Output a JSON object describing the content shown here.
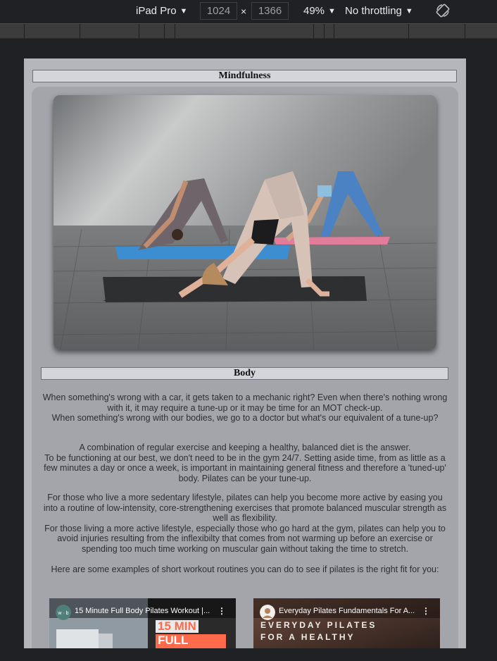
{
  "devtools": {
    "device": "iPad Pro",
    "width": "1024",
    "height": "1366",
    "times": "×",
    "zoom": "49%",
    "throttling": "No throttling",
    "caret": "▼"
  },
  "page": {
    "main_heading": "Mindfulness",
    "hero_alt": "Three women doing downward dog yoga poses on mats",
    "sub_heading": "Body",
    "paragraphs": [
      "When something's wrong with a car, it gets taken to a mechanic right? Even when there's nothing wrong with it, it may require a tune-up or it may be time for an MOT check-up.\nWhen something's wrong with our bodies, we go to a doctor but what's our equivalent of a tune-up?",
      "A combination of regular exercise and keeping a healthy, balanced diet is the answer.\nTo be functioning at our best, we don't need to be in the gym 24/7. Setting aside time, from as little as a few minutes a day or once a week, is important in maintaining general fitness and therefore a 'tuned-up' body. Pilates can be your tune-up.",
      "For those who live a more sedentary lifestyle, pilates can help you become more active by easing you into a routine of low-intensity, core-strengthening exercises that promote balanced muscular strength as well as flexibility.\nFor those living a more active lifestyle, especially those who go hard at the gym, pilates can help you to avoid injuries resulting from the inflexibilty that comes from not warming up before an exercise or spending too much time working on muscular gain without taking the time to stretch.",
      "Here are some examples of short workout routines you can do to see if pilates is the right fit for you:"
    ],
    "videos": [
      {
        "title": "15 Minute Full Body Pilates Workout |...",
        "overlay_line1": "15 MIN",
        "overlay_line2": "FULL BODY",
        "dots": "⋮"
      },
      {
        "title": "Everyday Pilates Fundamentals For A...",
        "overlay_line1": "EVERYDAY PILATES",
        "overlay_line2": "FOR A HEALTHY",
        "dots": "⋮"
      }
    ]
  }
}
